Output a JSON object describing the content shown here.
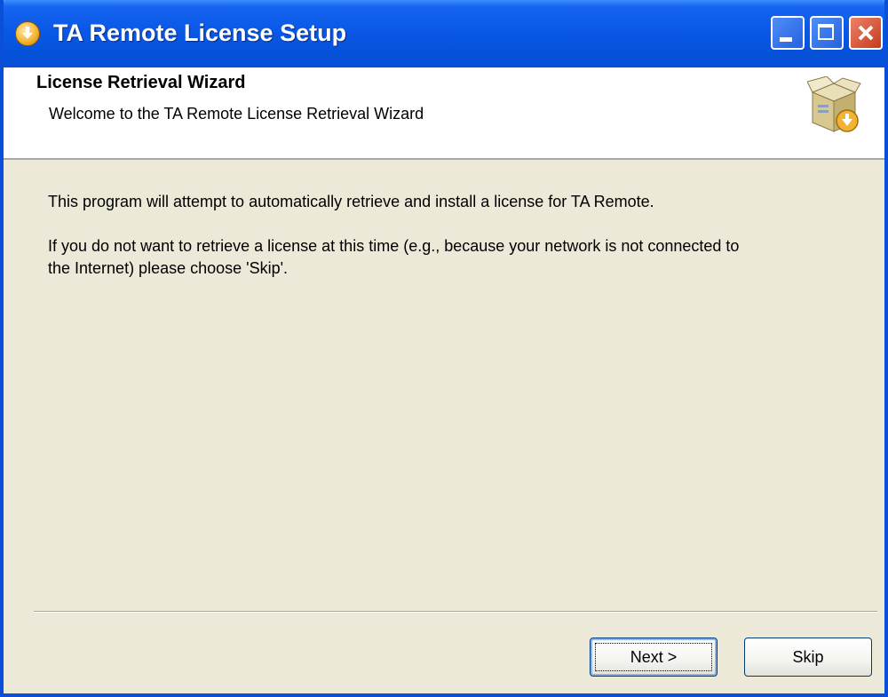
{
  "window": {
    "title": "TA Remote License Setup",
    "icon": "setup-download-icon",
    "controls": {
      "minimize_icon": "minimize-icon",
      "maximize_icon": "maximize-icon",
      "close_icon": "close-icon"
    }
  },
  "header": {
    "title": "License Retrieval Wizard",
    "subtitle": "Welcome to the TA Remote License Retrieval Wizard",
    "icon": "software-box-download-icon"
  },
  "content": {
    "paragraphs": [
      "This program will attempt to automatically retrieve and install a license for TA Remote.",
      "If you do not want to retrieve a license at this time (e.g., because your network is not connected to the Internet) please choose 'Skip'."
    ]
  },
  "buttons": {
    "next_label": "Next >",
    "skip_label": "Skip"
  },
  "colors": {
    "titlebar": "#0a58e6",
    "dialog_background": "#ece9d8",
    "close_button": "#c63b1d"
  }
}
